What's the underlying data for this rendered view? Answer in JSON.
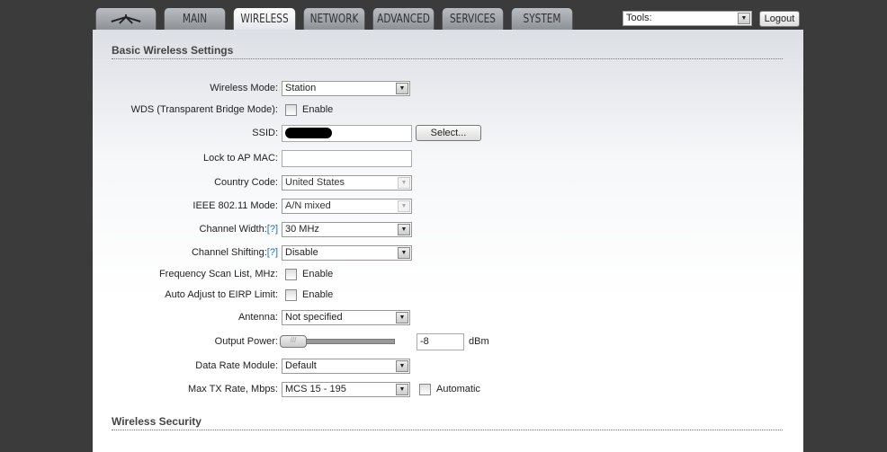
{
  "tabs": [
    {
      "label": ""
    },
    {
      "label": "MAIN"
    },
    {
      "label": "WIRELESS"
    },
    {
      "label": "NETWORK"
    },
    {
      "label": "ADVANCED"
    },
    {
      "label": "SERVICES"
    },
    {
      "label": "SYSTEM"
    }
  ],
  "tools": {
    "value": "Tools:",
    "logout": "Logout"
  },
  "sections": {
    "basic": "Basic Wireless Settings",
    "security": "Wireless Security"
  },
  "form": {
    "wireless_mode": {
      "label": "Wireless Mode:",
      "value": "Station"
    },
    "wds": {
      "label": "WDS (Transparent Bridge Mode):",
      "option": "Enable"
    },
    "ssid": {
      "label": "SSID:",
      "button": "Select..."
    },
    "lock_mac": {
      "label": "Lock to AP MAC:",
      "value": ""
    },
    "country": {
      "label": "Country Code:",
      "value": "United States"
    },
    "ieee": {
      "label": "IEEE 802.11 Mode:",
      "value": "A/N mixed"
    },
    "channel_width": {
      "label": "Channel Width:",
      "help": "[?]",
      "value": "30 MHz"
    },
    "channel_shift": {
      "label": "Channel Shifting:",
      "help": "[?]",
      "value": "Disable"
    },
    "freq_scan": {
      "label": "Frequency Scan List, MHz:",
      "option": "Enable"
    },
    "eirp": {
      "label": "Auto Adjust to EIRP Limit:",
      "option": "Enable"
    },
    "antenna": {
      "label": "Antenna:",
      "value": "Not specified"
    },
    "output_power": {
      "label": "Output Power:",
      "value": "-8",
      "unit": "dBm",
      "slider_fraction": 0
    },
    "data_rate": {
      "label": "Data Rate Module:",
      "value": "Default"
    },
    "max_tx": {
      "label": "Max TX Rate, Mbps:",
      "value": "MCS 15 - 195",
      "option": "Automatic"
    }
  }
}
